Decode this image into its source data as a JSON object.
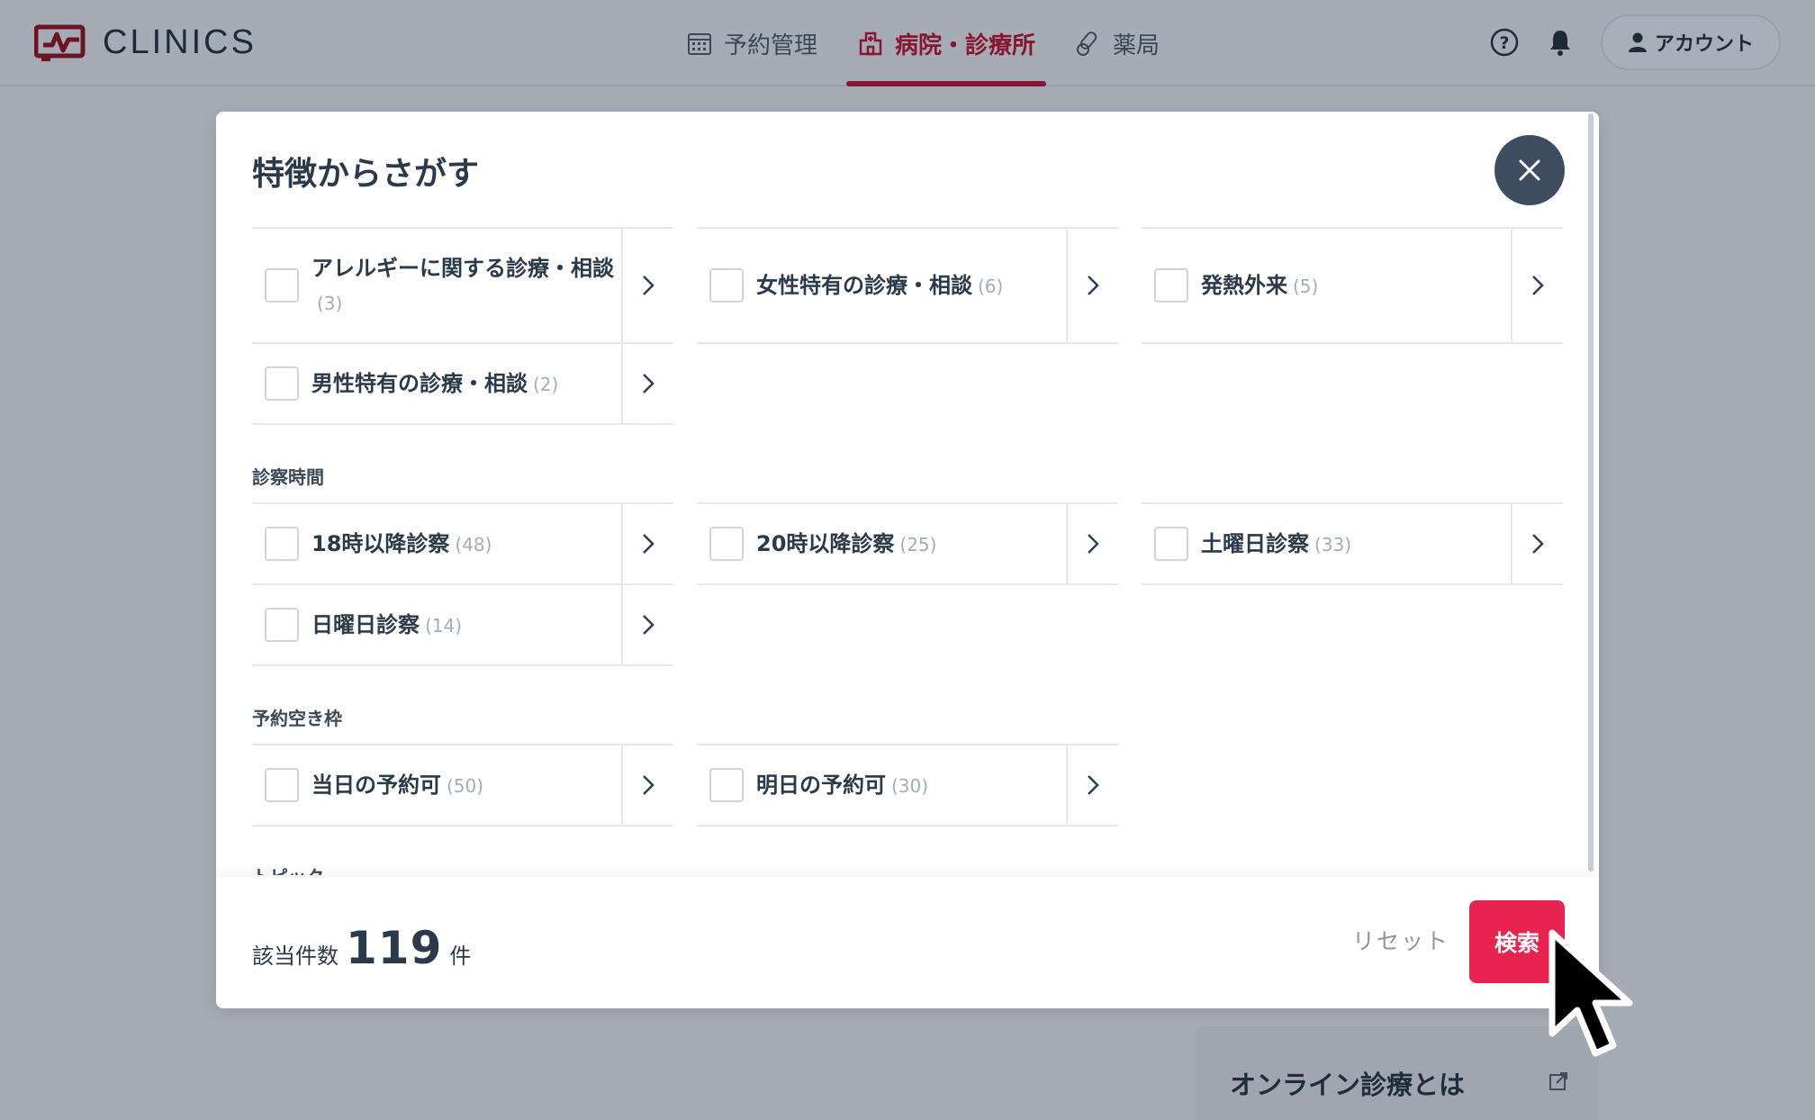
{
  "header": {
    "logo_text": "CLINICS",
    "nav": [
      {
        "label": "予約管理",
        "icon": "calendar-icon",
        "active": false
      },
      {
        "label": "病院・診療所",
        "icon": "hospital-icon",
        "active": true
      },
      {
        "label": "薬局",
        "icon": "pill-icon",
        "active": false
      }
    ],
    "account_label": "アカウント",
    "accent_color": "#8a1530"
  },
  "modal": {
    "title": "特徴からさがす",
    "sections": [
      {
        "heading": "",
        "items": [
          {
            "label": "アレルギーに関する診療・相談",
            "count": "(3)",
            "checked": false
          },
          {
            "label": "女性特有の診療・相談",
            "count": "(6)",
            "checked": false
          },
          {
            "label": "発熱外来",
            "count": "(5)",
            "checked": false
          },
          {
            "label": "男性特有の診療・相談",
            "count": "(2)",
            "checked": false
          }
        ]
      },
      {
        "heading": "診察時間",
        "items": [
          {
            "label": "18時以降診察",
            "count": "(48)",
            "checked": false
          },
          {
            "label": "20時以降診察",
            "count": "(25)",
            "checked": false
          },
          {
            "label": "土曜日診察",
            "count": "(33)",
            "checked": false
          },
          {
            "label": "日曜日診察",
            "count": "(14)",
            "checked": false
          }
        ]
      },
      {
        "heading": "予約空き枠",
        "items": [
          {
            "label": "当日の予約可",
            "count": "(50)",
            "checked": false
          },
          {
            "label": "明日の予約可",
            "count": "(30)",
            "checked": false
          }
        ]
      },
      {
        "heading": "トピック",
        "items": []
      }
    ],
    "footer": {
      "result_label": "該当件数",
      "result_count": "119",
      "result_unit": "件",
      "reset_label": "リセット",
      "search_label": "検索",
      "search_color": "#e8234f"
    }
  },
  "background_card": {
    "title": "オンライン診療とは"
  }
}
